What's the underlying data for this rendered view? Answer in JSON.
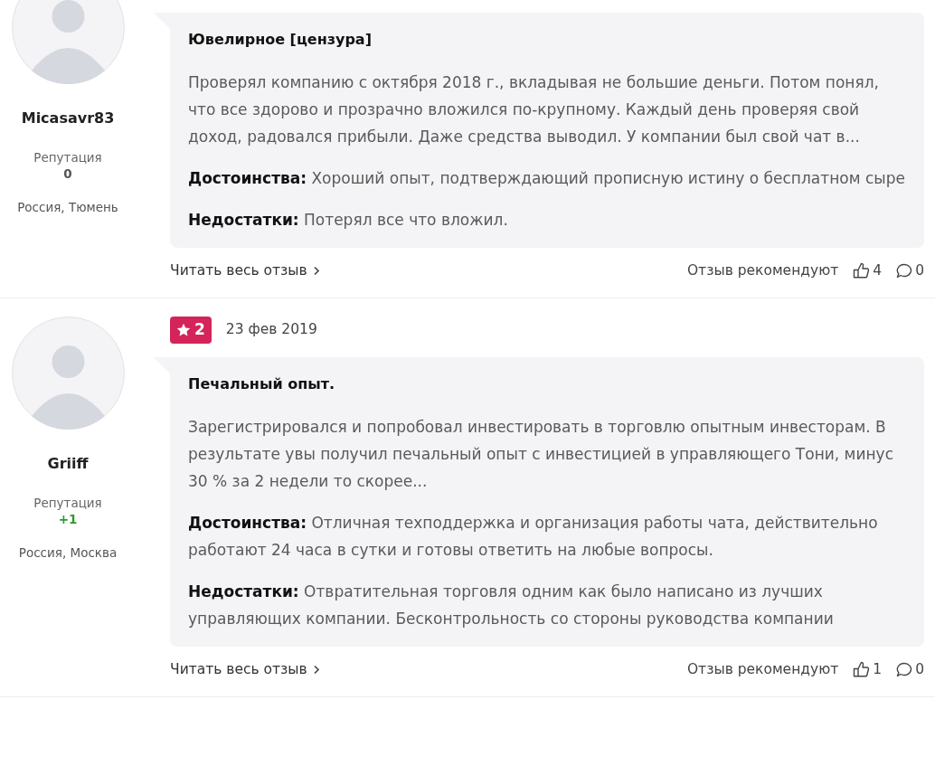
{
  "reviews": [
    {
      "author": {
        "name": "Micasavr83",
        "reputation_label": "Репутация",
        "reputation": "0",
        "reputation_positive": false,
        "location": "Россия, Тюмень"
      },
      "title": "Ювелирное [цензура]",
      "text": "Проверял компанию с октября 2018 г., вкладывая не большие деньги. Потом понял, что все здорово и прозрачно вложился по-крупному. Каждый день проверяя свой доход, радовался прибыли. Даже средства выводил. У компании был свой чат в...",
      "pros": "**Достоинства:** Хороший опыт, подтверждающий прописную истину о бесплатном сыре",
      "cons": "**Недостатки:** Потерял все что вложил.",
      "read_more": "Читать весь отзыв",
      "recommend_label": "Отзыв рекомендуют",
      "likes": "4",
      "comments": "0"
    },
    {
      "author": {
        "name": "Griiff",
        "reputation_label": "Репутация",
        "reputation": "+1",
        "reputation_positive": true,
        "location": "Россия, Москва"
      },
      "rating": "2",
      "date": "23 фев 2019",
      "title": "Печальный опыт.",
      "text": "Зарегистрировался и попробовал инвестировать в торговлю опытным инвесторам. В результате увы получил печальный опыт с инвестицией в управляющего Тони, минус 30 % за 2 недели то скорее...",
      "pros": "**Достоинства:** Отличная техподдержка и организация работы чата, действительно работают 24 часа в сутки и готовы ответить на любые вопросы.",
      "cons": "**Недостатки:** Отвратительная торговля одним как было написано из лучших управляющих компании. Бесконтрольность со стороны руководства компании",
      "read_more": "Читать весь отзыв",
      "recommend_label": "Отзыв рекомендуют",
      "likes": "1",
      "comments": "0"
    }
  ]
}
